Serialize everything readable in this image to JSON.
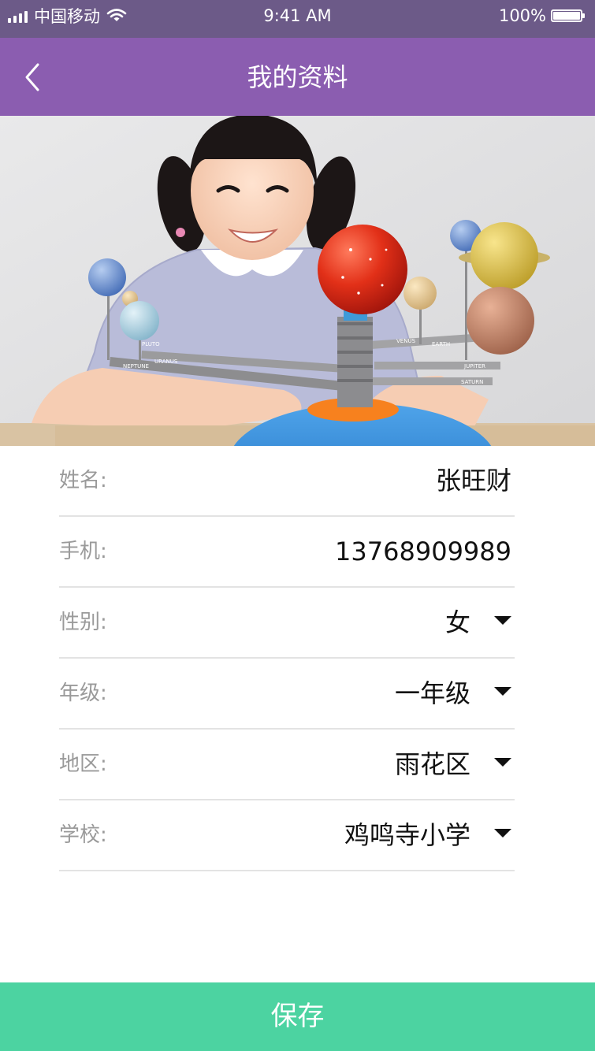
{
  "status_bar": {
    "carrier": "中国移动",
    "time": "9:41 AM",
    "battery": "100%"
  },
  "nav": {
    "title": "我的资料",
    "back_icon": "chevron-left-icon"
  },
  "profile": {
    "name": {
      "label": "姓名:",
      "value": "张旺财"
    },
    "phone": {
      "label": "手机:",
      "value": "13768909989"
    },
    "gender": {
      "label": "性别:",
      "value": "女"
    },
    "grade": {
      "label": "年级:",
      "value": "一年级"
    },
    "district": {
      "label": "地区:",
      "value": "雨花区"
    },
    "school": {
      "label": "学校:",
      "value": "鸡鸣寺小学"
    }
  },
  "hero_planet_labels": [
    "PLUTO",
    "URANUS",
    "NEPTUNE",
    "VENUS",
    "EARTH",
    "JUPITER",
    "SATURN"
  ],
  "save_label": "保存",
  "colors": {
    "status_bar": "#6c5a88",
    "nav": "#8b5db0",
    "save": "#4cd3a1",
    "label": "#9a9a9a",
    "value": "#111111"
  }
}
